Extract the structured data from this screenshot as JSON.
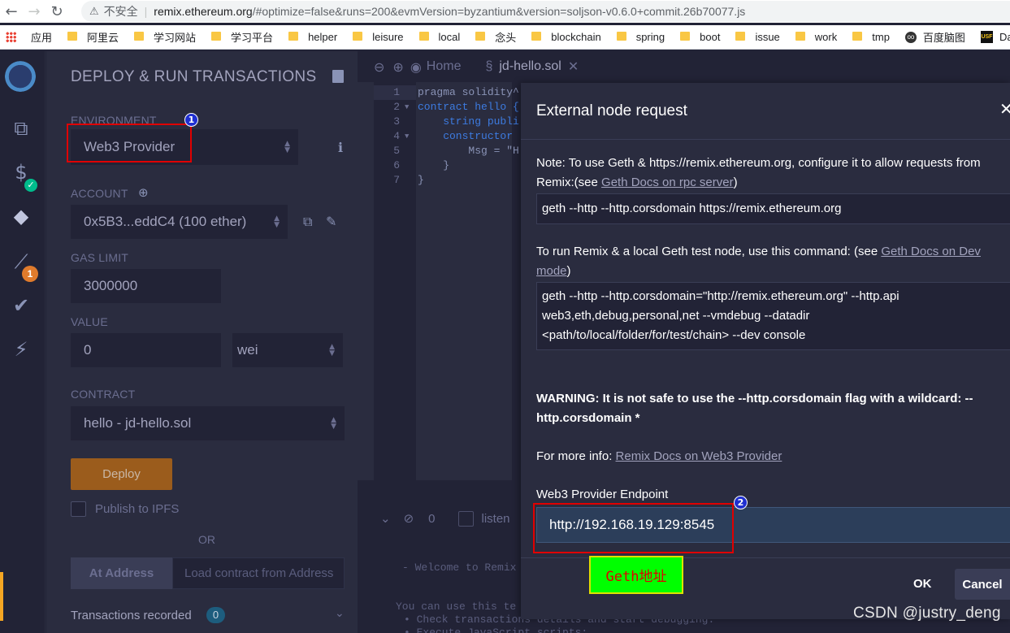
{
  "browser": {
    "insecure_label": "不安全",
    "url_host": "remix.ethereum.org",
    "url_rest": "/#optimize=false&runs=200&evmVersion=byzantium&version=soljson-v0.6.0+commit.26b70077.js",
    "bookmarks": [
      "应用",
      "阿里云",
      "学习网站",
      "学习平台",
      "helper",
      "leisure",
      "local",
      "念头",
      "blockchain",
      "spring",
      "boot",
      "issue",
      "work",
      "tmp",
      "百度脑图",
      "Data Structu"
    ]
  },
  "iconbar": {
    "badge_count": "1"
  },
  "panel": {
    "title": "DEPLOY & RUN TRANSACTIONS",
    "environment_label": "ENVIRONMENT",
    "environment_value": "Web3 Provider",
    "account_label": "ACCOUNT",
    "account_value": "0x5B3...eddC4 (100 ether)",
    "gas_limit_label": "GAS LIMIT",
    "gas_limit_value": "3000000",
    "value_label": "VALUE",
    "value_amount": "0",
    "value_unit": "wei",
    "contract_label": "CONTRACT",
    "contract_value": "hello - jd-hello.sol",
    "deploy_label": "Deploy",
    "publish_label": "Publish to IPFS",
    "or_label": "OR",
    "at_address_label": "At Address",
    "at_address_placeholder": "Load contract from Address",
    "transactions_label": "Transactions recorded",
    "transactions_count": "0"
  },
  "annotations": {
    "badge_one": "1",
    "badge_two": "2",
    "geth_note": "Geth地址"
  },
  "editor": {
    "home_tab": "Home",
    "file_tab": "jd-hello.sol",
    "lines": [
      "1",
      "2",
      "3",
      "4",
      "5",
      "6",
      "7"
    ],
    "code": [
      "pragma solidity^",
      "contract hello {",
      "    string publi",
      "    constructor",
      "        Msg = \"H",
      "    }",
      "}"
    ],
    "terminal_count": "0",
    "terminal_listen": "listen",
    "terminal_welcome": "- Welcome to Remix",
    "terminal_use": "You can use this te",
    "terminal_check": "• Check transactions details and start debugging.",
    "terminal_exec": "• Execute JavaScript scripts:"
  },
  "modal": {
    "title": "External node request",
    "close_glyph": "✕",
    "note_line1": "Note: To use Geth & https://remix.ethereum.org, configure it to allow requests from",
    "note_line2_prefix": "Remix:(see ",
    "note_link1": "Geth Docs on rpc server",
    "note_line2_suffix": ")",
    "cmd1": "geth --http --http.corsdomain https://remix.ethereum.org",
    "run_line1_prefix": "To run Remix & a local Geth test node, use this command: (see ",
    "run_link_part1": "Geth Docs on Dev",
    "run_link_part2": "mode",
    "run_line2_suffix": ")",
    "cmd2_line1": "geth --http --http.corsdomain=\"http://remix.ethereum.org\" --http.api",
    "cmd2_line2": "web3,eth,debug,personal,net --vmdebug --datadir",
    "cmd2_line3": "<path/to/local/folder/for/test/chain> --dev console",
    "warning_line1": "WARNING: It is not safe to use the --http.corsdomain flag with a wildcard: --",
    "warning_line2": "http.corsdomain *",
    "more_info_prefix": "For more info: ",
    "more_info_link": "Remix Docs on Web3 Provider",
    "endpoint_label": "Web3 Provider Endpoint",
    "endpoint_value": "http://192.168.19.129:8545",
    "ok_label": "OK",
    "cancel_label": "Cancel"
  },
  "watermark": "CSDN @justry_deng"
}
